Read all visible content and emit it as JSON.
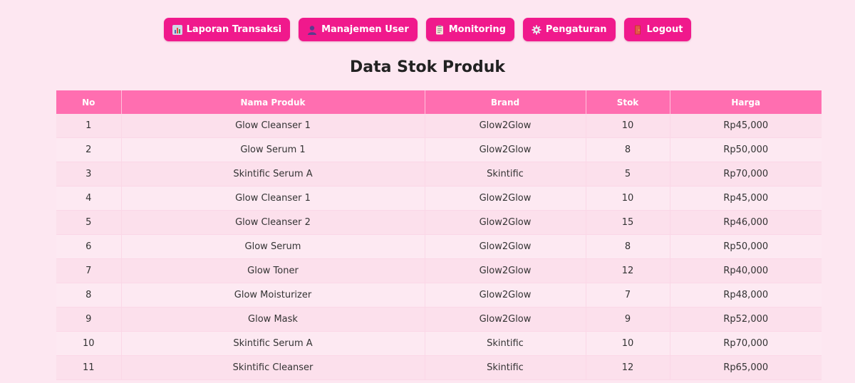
{
  "nav": {
    "items": [
      {
        "label": "Laporan Transaksi",
        "icon": "bar-chart-icon"
      },
      {
        "label": "Manajemen User",
        "icon": "user-icon"
      },
      {
        "label": "Monitoring",
        "icon": "clipboard-icon"
      },
      {
        "label": "Pengaturan",
        "icon": "gear-icon"
      },
      {
        "label": "Logout",
        "icon": "door-icon"
      }
    ]
  },
  "page": {
    "title": "Data Stok Produk"
  },
  "table": {
    "headers": [
      "No",
      "Nama Produk",
      "Brand",
      "Stok",
      "Harga"
    ],
    "rows": [
      [
        "1",
        "Glow Cleanser 1",
        "Glow2Glow",
        "10",
        "Rp45,000"
      ],
      [
        "2",
        "Glow Serum 1",
        "Glow2Glow",
        "8",
        "Rp50,000"
      ],
      [
        "3",
        "Skintific Serum A",
        "Skintific",
        "5",
        "Rp70,000"
      ],
      [
        "4",
        "Glow Cleanser 1",
        "Glow2Glow",
        "10",
        "Rp45,000"
      ],
      [
        "5",
        "Glow Cleanser 2",
        "Glow2Glow",
        "15",
        "Rp46,000"
      ],
      [
        "6",
        "Glow Serum",
        "Glow2Glow",
        "8",
        "Rp50,000"
      ],
      [
        "7",
        "Glow Toner",
        "Glow2Glow",
        "12",
        "Rp40,000"
      ],
      [
        "8",
        "Glow Moisturizer",
        "Glow2Glow",
        "7",
        "Rp48,000"
      ],
      [
        "9",
        "Glow Mask",
        "Glow2Glow",
        "9",
        "Rp52,000"
      ],
      [
        "10",
        "Skintific Serum A",
        "Skintific",
        "10",
        "Rp70,000"
      ],
      [
        "11",
        "Skintific Cleanser",
        "Skintific",
        "12",
        "Rp65,000"
      ]
    ]
  },
  "colors": {
    "background": "#fde7f1",
    "button": "#f0198c",
    "header": "#ff6eb0"
  }
}
